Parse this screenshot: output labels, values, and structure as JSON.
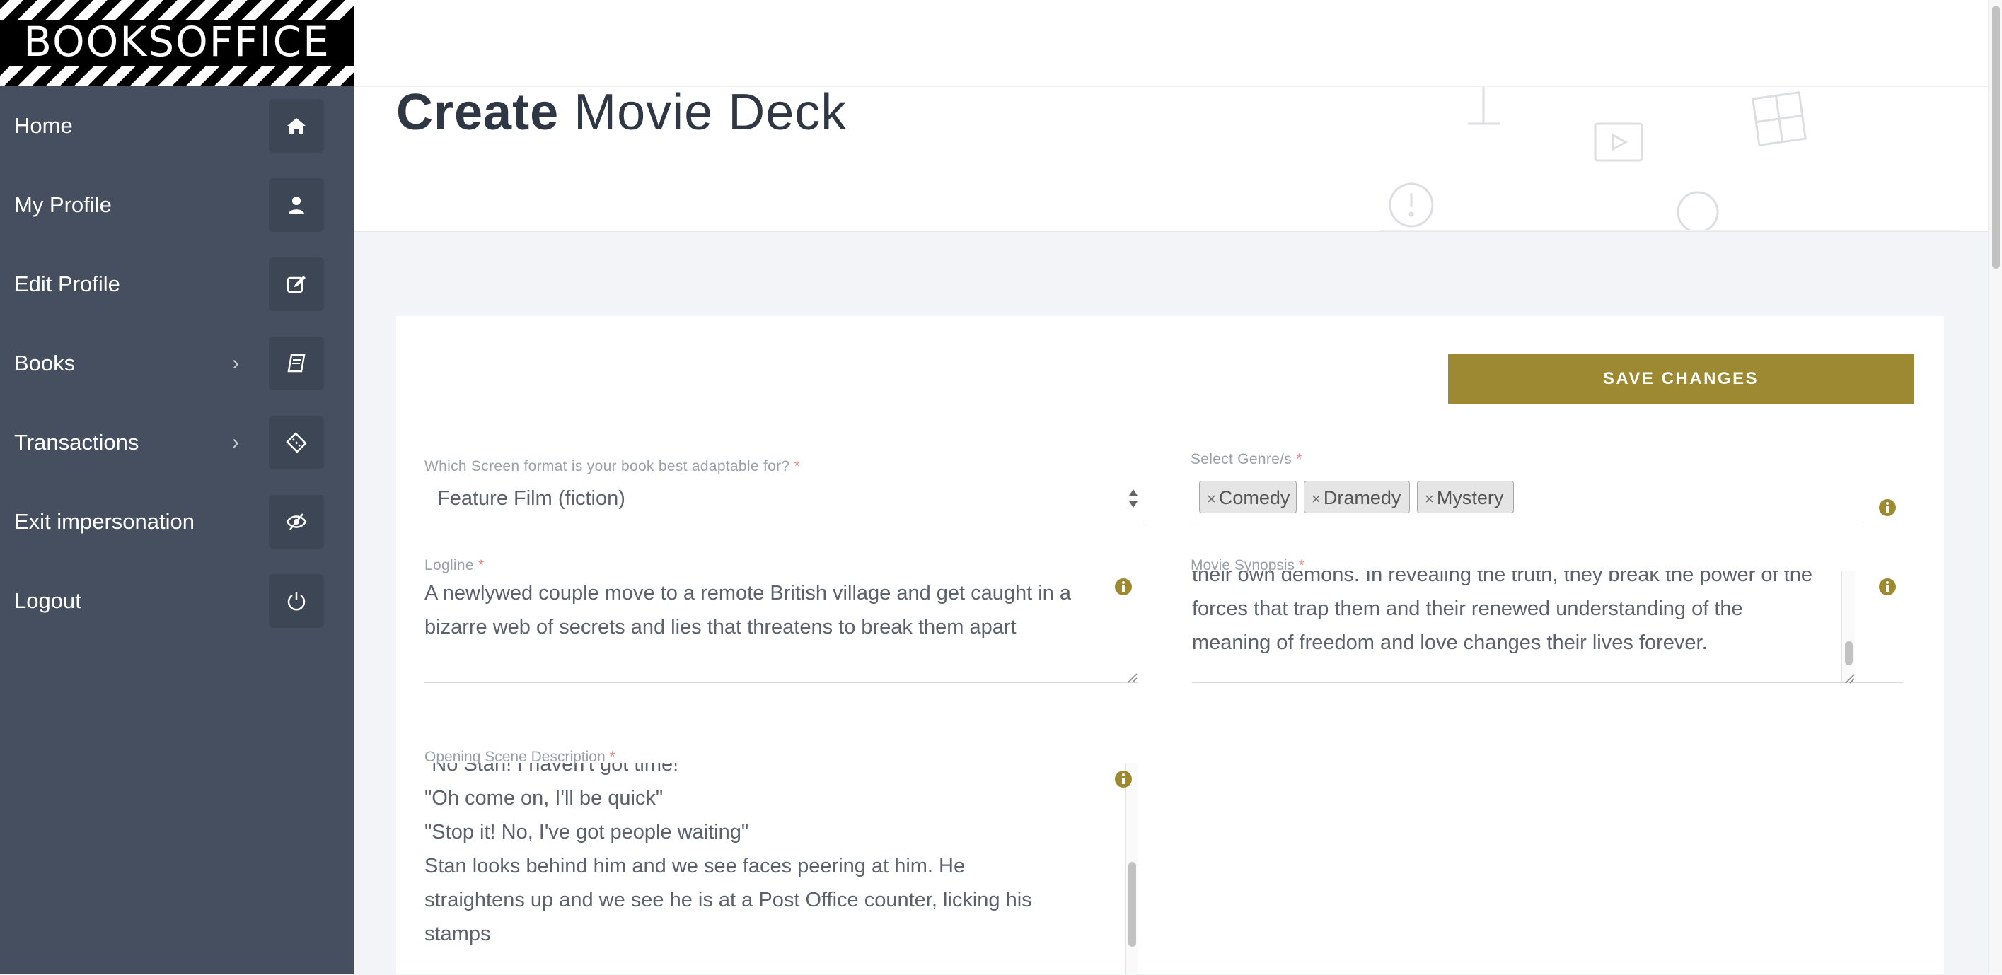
{
  "brand": {
    "logo_text": "BOOKSOFFICE"
  },
  "sidebar": {
    "items": [
      {
        "label": "Home",
        "icon": "home-icon",
        "has_submenu": false
      },
      {
        "label": "My Profile",
        "icon": "user-icon",
        "has_submenu": false
      },
      {
        "label": "Edit Profile",
        "icon": "edit-icon",
        "has_submenu": false
      },
      {
        "label": "Books",
        "icon": "book-icon",
        "has_submenu": true
      },
      {
        "label": "Transactions",
        "icon": "ticket-icon",
        "has_submenu": true
      },
      {
        "label": "Exit impersonation",
        "icon": "eye-slash-icon",
        "has_submenu": false
      },
      {
        "label": "Logout",
        "icon": "power-icon",
        "has_submenu": false
      }
    ],
    "chevron": "›"
  },
  "page": {
    "title_bold": "Create",
    "title_light": "Movie Deck"
  },
  "form": {
    "save_label": "SAVE CHANGES",
    "screen_format": {
      "label": "Which Screen format is your book best adaptable for?",
      "required_mark": "*",
      "value": "Feature Film (fiction)"
    },
    "genres": {
      "label": "Select Genre/s",
      "required_mark": "*",
      "remove_glyph": "×",
      "tags": [
        "Comedy",
        "Dramedy",
        "Mystery"
      ]
    },
    "logline": {
      "label": "Logline",
      "required_mark": "*",
      "lines": [
        "A newlywed couple move to a remote British village and get caught in a",
        "bizarre web of secrets and lies that threatens to break them apart"
      ]
    },
    "synopsis": {
      "label": "Movie Synopsis",
      "required_mark": "*",
      "lines": [
        "their own demons. In revealing the truth, they break the power of the",
        "forces that trap them and their renewed understanding of the",
        "meaning of freedom and love changes their lives forever."
      ]
    },
    "opening_scene": {
      "label": "Opening Scene Description",
      "required_mark": "*",
      "lines": [
        "\"No Stan! I haven't got time!\"",
        "\"Oh come on, I'll be quick\"",
        "\"Stop it! No, I've got people waiting\"",
        "Stan looks behind him and we see faces peering at him. He",
        "straightens up and we see he is at a Post Office counter, licking his",
        "stamps"
      ]
    }
  },
  "colors": {
    "sidebar_bg": "#454f5f",
    "accent_gold": "#9e8933",
    "required_red": "#e68a8a"
  }
}
